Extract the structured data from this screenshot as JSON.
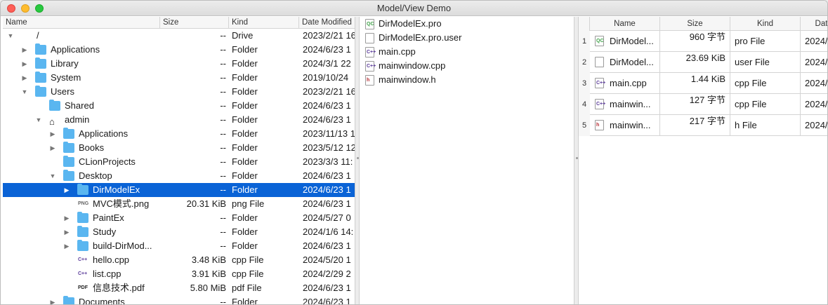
{
  "window": {
    "title": "Model/View Demo"
  },
  "colors": {
    "selection": "#0a63d6",
    "folder": "#5ab6f0"
  },
  "tree": {
    "columns": [
      "Name",
      "Size",
      "Kind",
      "Date Modified"
    ],
    "rows": [
      {
        "name": "/",
        "size": "--",
        "kind": "Drive",
        "date": "2023/2/21 16",
        "depth": 0,
        "arrow": "down",
        "icon": "drive-icon"
      },
      {
        "name": "Applications",
        "size": "--",
        "kind": "Folder",
        "date": "2024/6/23 1",
        "depth": 1,
        "arrow": "right",
        "icon": "folder-icon"
      },
      {
        "name": "Library",
        "size": "--",
        "kind": "Folder",
        "date": "2024/3/1 22",
        "depth": 1,
        "arrow": "right",
        "icon": "folder-icon"
      },
      {
        "name": "System",
        "size": "--",
        "kind": "Folder",
        "date": "2019/10/24",
        "depth": 1,
        "arrow": "right",
        "icon": "folder-icon"
      },
      {
        "name": "Users",
        "size": "--",
        "kind": "Folder",
        "date": "2023/2/21 16",
        "depth": 1,
        "arrow": "down",
        "icon": "folder-icon"
      },
      {
        "name": "Shared",
        "size": "--",
        "kind": "Folder",
        "date": "2024/6/23 1",
        "depth": 2,
        "arrow": "",
        "icon": "folder-icon"
      },
      {
        "name": "admin",
        "size": "--",
        "kind": "Folder",
        "date": "2024/6/23 1",
        "depth": 2,
        "arrow": "down",
        "icon": "home-icon"
      },
      {
        "name": "Applications",
        "size": "--",
        "kind": "Folder",
        "date": "2023/11/13 1",
        "depth": 3,
        "arrow": "right",
        "icon": "folder-icon"
      },
      {
        "name": "Books",
        "size": "--",
        "kind": "Folder",
        "date": "2023/5/12 12",
        "depth": 3,
        "arrow": "right",
        "icon": "folder-icon"
      },
      {
        "name": "CLionProjects",
        "size": "--",
        "kind": "Folder",
        "date": "2023/3/3 11:",
        "depth": 3,
        "arrow": "",
        "icon": "folder-icon"
      },
      {
        "name": "Desktop",
        "size": "--",
        "kind": "Folder",
        "date": "2024/6/23 1",
        "depth": 3,
        "arrow": "down",
        "icon": "folder-icon"
      },
      {
        "name": "DirModelEx",
        "size": "--",
        "kind": "Folder",
        "date": "2024/6/23 1",
        "depth": 4,
        "arrow": "right",
        "icon": "folder-icon",
        "selected": true
      },
      {
        "name": "MVC模式.png",
        "size": "20.31 KiB",
        "kind": "png File",
        "date": "2024/6/23 1",
        "depth": 4,
        "arrow": "",
        "icon": "image-file-icon"
      },
      {
        "name": "PaintEx",
        "size": "--",
        "kind": "Folder",
        "date": "2024/5/27 0",
        "depth": 4,
        "arrow": "right",
        "icon": "folder-icon"
      },
      {
        "name": "Study",
        "size": "--",
        "kind": "Folder",
        "date": "2024/1/6 14:",
        "depth": 4,
        "arrow": "right",
        "icon": "folder-icon"
      },
      {
        "name": "build-DirMod...",
        "size": "--",
        "kind": "Folder",
        "date": "2024/6/23 1",
        "depth": 4,
        "arrow": "right",
        "icon": "folder-icon"
      },
      {
        "name": "hello.cpp",
        "size": "3.48 KiB",
        "kind": "cpp File",
        "date": "2024/5/20 1",
        "depth": 4,
        "arrow": "",
        "icon": "cpp-file-icon"
      },
      {
        "name": "list.cpp",
        "size": "3.91 KiB",
        "kind": "cpp File",
        "date": "2024/2/29 2",
        "depth": 4,
        "arrow": "",
        "icon": "cpp-file-icon"
      },
      {
        "name": "信息技术.pdf",
        "size": "5.80 MiB",
        "kind": "pdf File",
        "date": "2024/6/23 1",
        "depth": 4,
        "arrow": "",
        "icon": "pdf-file-icon"
      },
      {
        "name": "Documents",
        "size": "--",
        "kind": "Folder",
        "date": "2024/6/23 1",
        "depth": 3,
        "arrow": "right",
        "icon": "folder-icon"
      }
    ]
  },
  "list": {
    "items": [
      {
        "name": "DirModelEx.pro",
        "icon": "qt-project-file-icon"
      },
      {
        "name": "DirModelEx.pro.user",
        "icon": "file-icon"
      },
      {
        "name": "main.cpp",
        "icon": "cpp-file-icon"
      },
      {
        "name": "mainwindow.cpp",
        "icon": "cpp-file-icon"
      },
      {
        "name": "mainwindow.h",
        "icon": "header-file-icon"
      }
    ]
  },
  "table": {
    "columns": [
      "Name",
      "Size",
      "Kind",
      "Dat"
    ],
    "rows": [
      {
        "num": "1",
        "name": "DirModel...",
        "size": "960 字节",
        "kind": "pro File",
        "date": "2024/",
        "icon": "qt-project-file-icon"
      },
      {
        "num": "2",
        "name": "DirModel...",
        "size": "23.69 KiB",
        "kind": "user File",
        "date": "2024/",
        "icon": "file-icon"
      },
      {
        "num": "3",
        "name": "main.cpp",
        "size": "1.44 KiB",
        "kind": "cpp File",
        "date": "2024/",
        "icon": "cpp-file-icon"
      },
      {
        "num": "4",
        "name": "mainwin...",
        "size": "127 字节",
        "kind": "cpp File",
        "date": "2024/",
        "icon": "cpp-file-icon"
      },
      {
        "num": "5",
        "name": "mainwin...",
        "size": "217 字节",
        "kind": "h File",
        "date": "2024/",
        "icon": "header-file-icon"
      }
    ]
  }
}
